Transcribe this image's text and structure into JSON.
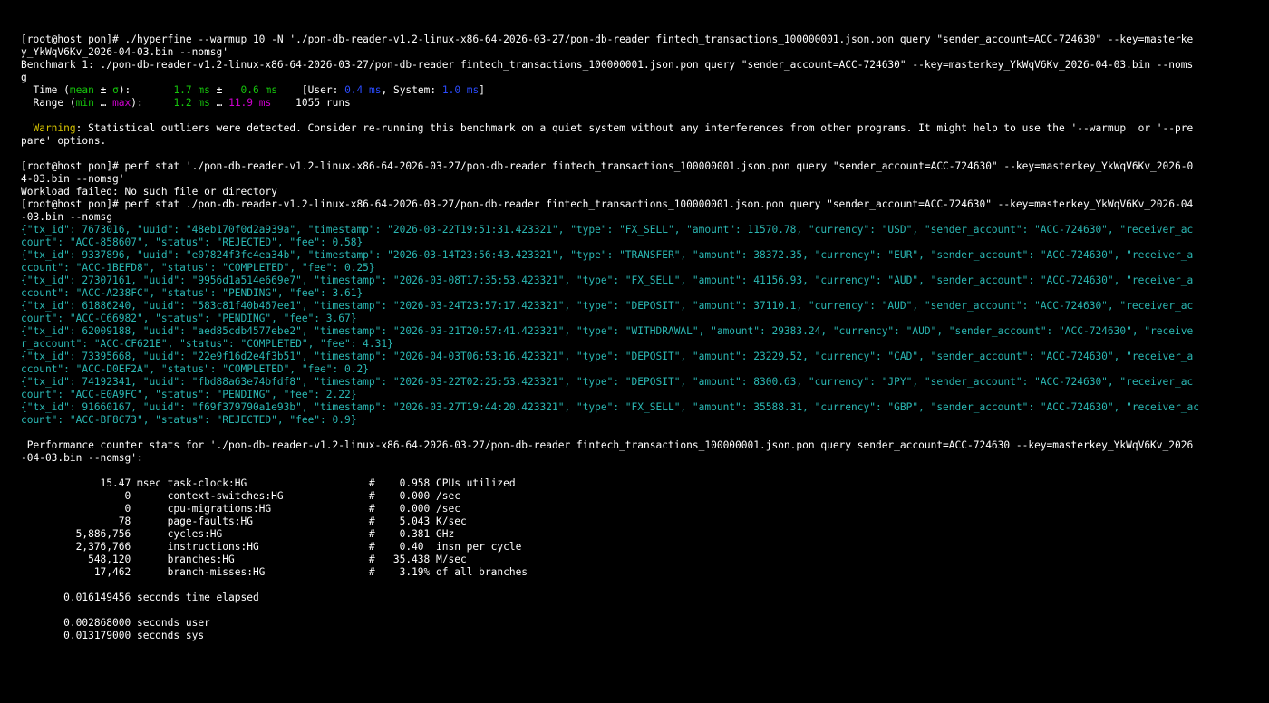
{
  "terminal": {
    "cmd1": [
      "[root@host pon]# ./hyperfine --warmup 10 -N './pon-db-reader-v1.2-linux-x86-64-2026-03-27/pon-db-reader fintech_transactions_100000001.json.pon query \"sender_account=ACC-724630\" --key=masterke",
      "y_YkWqV6Kv_2026-04-03.bin --nomsg'"
    ],
    "bench_header": [
      "Benchmark 1: ./pon-db-reader-v1.2-linux-x86-64-2026-03-27/pon-db-reader fintech_transactions_100000001.json.pon query \"sender_account=ACC-724630\" --key=masterkey_YkWqV6Kv_2026-04-03.bin --noms",
      "g"
    ],
    "time": {
      "prefix": "  Time (",
      "mean": "mean",
      "pm": " ± ",
      "sigma": "σ",
      "mid": "):       ",
      "mean_val": "1.7 ms",
      "pm2": " ±   ",
      "sigma_val": "0.6 ms",
      "mid2": "    [User: ",
      "user": "0.4 ms",
      "sys_label": ", System: ",
      "sys": "1.0 ms",
      "end": "]"
    },
    "range": {
      "prefix": "  Range (",
      "min": "min",
      "dots": " … ",
      "max": "max",
      "mid": "):     ",
      "min_val": "1.2 ms",
      "dots2": " … ",
      "max_val": "11.9 ms",
      "runs": "    1055 runs"
    },
    "warning": {
      "label": "  Warning",
      "text1": ": Statistical outliers were detected. Consider re-running this benchmark on a quiet system without any interferences from other programs. It might help to use the '--warmup' or '--pre",
      "text2": "pare' options."
    },
    "cmd2": [
      "[root@host pon]# perf stat './pon-db-reader-v1.2-linux-x86-64-2026-03-27/pon-db-reader fintech_transactions_100000001.json.pon query \"sender_account=ACC-724630\" --key=masterkey_YkWqV6Kv_2026-0",
      "4-03.bin --nomsg'"
    ],
    "error": "Workload failed: No such file or directory",
    "cmd3": [
      "[root@host pon]# perf stat ./pon-db-reader-v1.2-linux-x86-64-2026-03-27/pon-db-reader fintech_transactions_100000001.json.pon query \"sender_account=ACC-724630\" --key=masterkey_YkWqV6Kv_2026-04",
      "-03.bin --nomsg"
    ],
    "json_lines": [
      "{\"tx_id\": 7673016, \"uuid\": \"48eb170f0d2a939a\", \"timestamp\": \"2026-03-22T19:51:31.423321\", \"type\": \"FX_SELL\", \"amount\": 11570.78, \"currency\": \"USD\", \"sender_account\": \"ACC-724630\", \"receiver_ac",
      "count\": \"ACC-858607\", \"status\": \"REJECTED\", \"fee\": 0.58}",
      "{\"tx_id\": 9337896, \"uuid\": \"e07824f3fc4ea34b\", \"timestamp\": \"2026-03-14T23:56:43.423321\", \"type\": \"TRANSFER\", \"amount\": 38372.35, \"currency\": \"EUR\", \"sender_account\": \"ACC-724630\", \"receiver_a",
      "ccount\": \"ACC-1BEFD8\", \"status\": \"COMPLETED\", \"fee\": 0.25}",
      "{\"tx_id\": 27307161, \"uuid\": \"9956d1a514e669e7\", \"timestamp\": \"2026-03-08T17:35:53.423321\", \"type\": \"FX_SELL\", \"amount\": 41156.93, \"currency\": \"AUD\", \"sender_account\": \"ACC-724630\", \"receiver_a",
      "ccount\": \"ACC-A238FC\", \"status\": \"PENDING\", \"fee\": 3.61}",
      "{\"tx_id\": 61886240, \"uuid\": \"583c81f40b467ee1\", \"timestamp\": \"2026-03-24T23:57:17.423321\", \"type\": \"DEPOSIT\", \"amount\": 37110.1, \"currency\": \"AUD\", \"sender_account\": \"ACC-724630\", \"receiver_ac",
      "count\": \"ACC-C66982\", \"status\": \"PENDING\", \"fee\": 3.67}",
      "{\"tx_id\": 62009188, \"uuid\": \"aed85cdb4577ebe2\", \"timestamp\": \"2026-03-21T20:57:41.423321\", \"type\": \"WITHDRAWAL\", \"amount\": 29383.24, \"currency\": \"AUD\", \"sender_account\": \"ACC-724630\", \"receive",
      "r_account\": \"ACC-CF621E\", \"status\": \"COMPLETED\", \"fee\": 4.31}",
      "{\"tx_id\": 73395668, \"uuid\": \"22e9f16d2e4f3b51\", \"timestamp\": \"2026-04-03T06:53:16.423321\", \"type\": \"DEPOSIT\", \"amount\": 23229.52, \"currency\": \"CAD\", \"sender_account\": \"ACC-724630\", \"receiver_a",
      "ccount\": \"ACC-D0EF2A\", \"status\": \"COMPLETED\", \"fee\": 0.2}",
      "{\"tx_id\": 74192341, \"uuid\": \"fbd88a63e74bfdf8\", \"timestamp\": \"2026-03-22T02:25:53.423321\", \"type\": \"DEPOSIT\", \"amount\": 8300.63, \"currency\": \"JPY\", \"sender_account\": \"ACC-724630\", \"receiver_ac",
      "count\": \"ACC-E0A9FC\", \"status\": \"PENDING\", \"fee\": 2.22}",
      "{\"tx_id\": 91660167, \"uuid\": \"f69f379790a1e93b\", \"timestamp\": \"2026-03-27T19:44:20.423321\", \"type\": \"FX_SELL\", \"amount\": 35588.31, \"currency\": \"GBP\", \"sender_account\": \"ACC-724630\", \"receiver_ac",
      "count\": \"ACC-BF8C73\", \"status\": \"REJECTED\", \"fee\": 0.9}"
    ],
    "perf_header": [
      " Performance counter stats for './pon-db-reader-v1.2-linux-x86-64-2026-03-27/pon-db-reader fintech_transactions_100000001.json.pon query sender_account=ACC-724630 --key=masterkey_YkWqV6Kv_2026",
      "-04-03.bin --nomsg':"
    ],
    "perf_stats": [
      "             15.47 msec task-clock:HG                    #    0.958 CPUs utilized",
      "                 0      context-switches:HG              #    0.000 /sec",
      "                 0      cpu-migrations:HG                #    0.000 /sec",
      "                78      page-faults:HG                   #    5.043 K/sec",
      "         5,886,756      cycles:HG                        #    0.381 GHz",
      "         2,376,766      instructions:HG                  #    0.40  insn per cycle",
      "           548,120      branches:HG                      #   35.438 M/sec",
      "            17,462      branch-misses:HG                 #    3.19% of all branches"
    ],
    "elapsed": "       0.016149456 seconds time elapsed",
    "user_time": "       0.002868000 seconds user",
    "sys_time": "       0.013179000 seconds sys"
  },
  "colors": {
    "background": "#000000",
    "text": "#ffffff",
    "green": "#16c60c",
    "magenta": "#d100d1",
    "blue": "#2b4cff",
    "yellow": "#d7c400",
    "cyan": "#2ab7b3"
  }
}
